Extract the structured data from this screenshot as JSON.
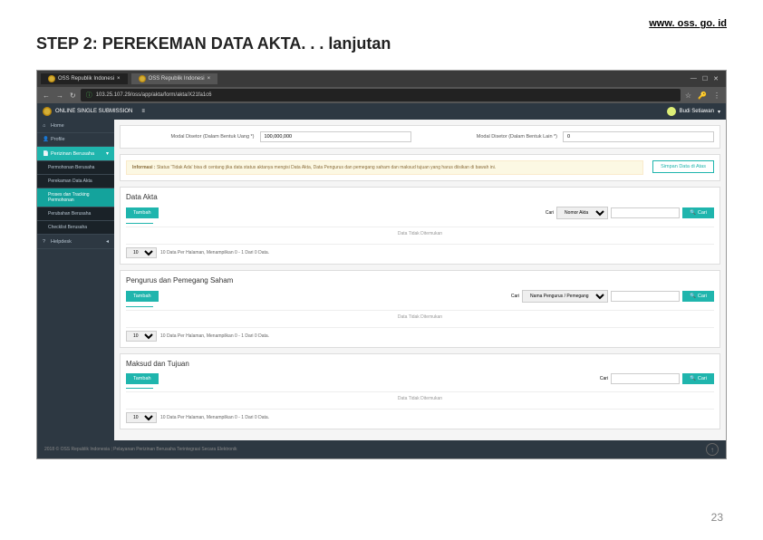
{
  "header": {
    "url_link": "www. oss. go. id",
    "title": "STEP 2: PEREKEMAN DATA AKTA. . . lanjutan"
  },
  "browser": {
    "tabs": [
      {
        "label": "OSS Republik Indonesi"
      },
      {
        "label": "OSS Republik Indonesi"
      }
    ],
    "address": "103.25.107.29/oss/app/akta/form/akta/X21fa1c6",
    "security_label": "ⓘ",
    "star_label": "☆",
    "key_label": "Key"
  },
  "app_header": {
    "title": "ONLINE SINGLE SUBMISSION",
    "user": "Budi Setiawan"
  },
  "sidebar": {
    "items": [
      {
        "icon": "home",
        "label": "Home"
      },
      {
        "icon": "user",
        "label": "Profile"
      },
      {
        "icon": "file",
        "label": "Perizinan Berusaha",
        "expandable": true
      },
      {
        "sub": true,
        "label": "Permohonan Berusaha"
      },
      {
        "sub": true,
        "label": "Perekaman Data Akta"
      },
      {
        "sub": true,
        "label": "Proses dan Tracking Permohonan",
        "current": true
      },
      {
        "sub": true,
        "label": "Perubahan Berusaha"
      },
      {
        "sub": true,
        "label": "Checklist Berusaha"
      },
      {
        "icon": "help",
        "label": "Helpdesk",
        "expandable": true
      }
    ]
  },
  "content": {
    "modal_row": {
      "label1": "Modal Disetor (Dalam Bentuk Uang *)",
      "value1": "100,000,000",
      "label2": "Modal Disetor (Dalam Bentuk Lain *)",
      "value2": "0"
    },
    "alert_prefix": "Informasi :",
    "alert_text": "Status 'Tidak Ada' bisa di centang jika data status aktanya mengisi Data Akta, Data Pengurus dan pemegang saham dan maksud tujuan yang harus diisikan di bawah ini.",
    "save_btn": "Simpan Data di Atas",
    "sections": [
      {
        "title": "Data Akta",
        "add_btn": "Tambah",
        "search_label": "Cari",
        "filter_option": "Nomor Akta",
        "search_btn": "Cari",
        "empty": "Data Tidak Ditemukan",
        "pager_text": "10 Data Per Halaman, Menampilkan 0 - 1 Dari 0 Data.",
        "pager_size": "10"
      },
      {
        "title": "Pengurus dan Pemegang Saham",
        "add_btn": "Tambah",
        "search_label": "Cari",
        "filter_option": "Nama Pengurus / Pemegang",
        "search_btn": "Cari",
        "empty": "Data Tidak Ditemukan",
        "pager_text": "10 Data Per Halaman, Menampilkan 0 - 1 Dari 0 Data.",
        "pager_size": "10"
      },
      {
        "title": "Maksud dan Tujuan",
        "add_btn": "Tambah",
        "search_label": "Cari",
        "filter_option": "",
        "search_btn": "Cari",
        "empty": "Data Tidak Ditemukan",
        "pager_text": "10 Data Per Halaman, Menampilkan 0 - 1 Dari 0 Data.",
        "pager_size": "10"
      }
    ]
  },
  "footer": {
    "copyright": "2018 © OSS Republik Indonesia",
    "tagline": "Pelayanan Perizinan Berusaha Terintegrasi Secara Elektronik"
  },
  "page_number": "23"
}
